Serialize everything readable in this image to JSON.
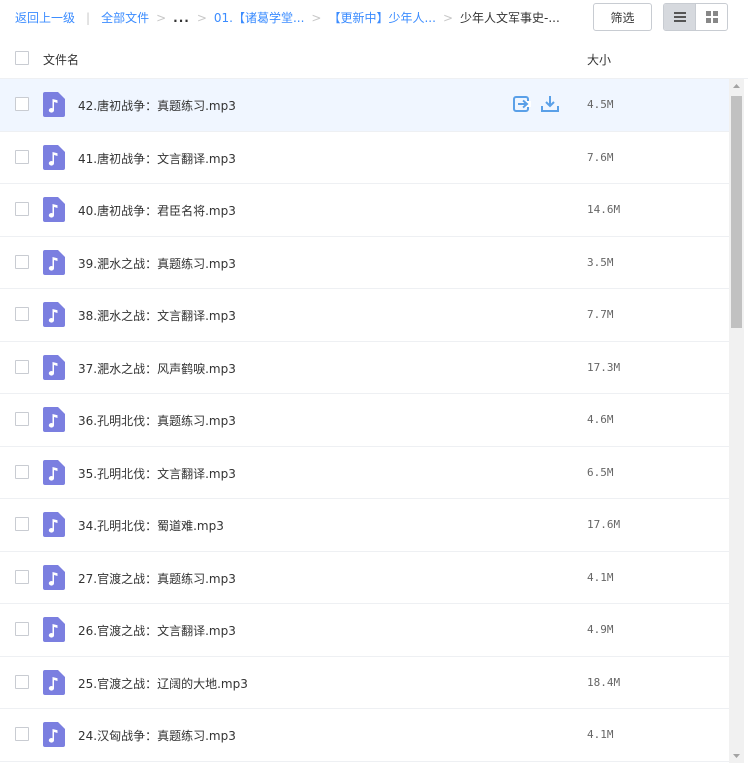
{
  "breadcrumb": {
    "back": "返回上一级",
    "separator": "|",
    "all_files": "全部文件",
    "dots": "...",
    "folder1": "01.【诸葛学堂...",
    "folder2": "【更新中】少年人...",
    "current": "少年人文军事史-...",
    "arrow": ">"
  },
  "toolbar": {
    "filter_label": "筛选",
    "view_list_icon": "list-view-icon",
    "view_grid_icon": "grid-view-icon"
  },
  "header": {
    "name_label": "文件名",
    "size_label": "大小"
  },
  "colors": {
    "accent": "#3b8cff",
    "file_icon": "#7b7fe0",
    "hover_row": "#f0f6ff"
  },
  "files": [
    {
      "name": "42.唐初战争：真题练习.mp3",
      "size": "4.5M"
    },
    {
      "name": "41.唐初战争：文言翻译.mp3",
      "size": "7.6M"
    },
    {
      "name": "40.唐初战争：君臣名将.mp3",
      "size": "14.6M"
    },
    {
      "name": "39.淝水之战：真题练习.mp3",
      "size": "3.5M"
    },
    {
      "name": "38.淝水之战：文言翻译.mp3",
      "size": "7.7M"
    },
    {
      "name": "37.淝水之战：风声鹤唳.mp3",
      "size": "17.3M"
    },
    {
      "name": "36.孔明北伐：真题练习.mp3",
      "size": "4.6M"
    },
    {
      "name": "35.孔明北伐：文言翻译.mp3",
      "size": "6.5M"
    },
    {
      "name": "34.孔明北伐：蜀道难.mp3",
      "size": "17.6M"
    },
    {
      "name": "27.官渡之战：真题练习.mp3",
      "size": "4.1M"
    },
    {
      "name": "26.官渡之战：文言翻译.mp3",
      "size": "4.9M"
    },
    {
      "name": "25.官渡之战：辽阔的大地.mp3",
      "size": "18.4M"
    },
    {
      "name": "24.汉匈战争：真题练习.mp3",
      "size": "4.1M"
    }
  ],
  "row_actions": [
    "share-icon",
    "download-icon"
  ]
}
